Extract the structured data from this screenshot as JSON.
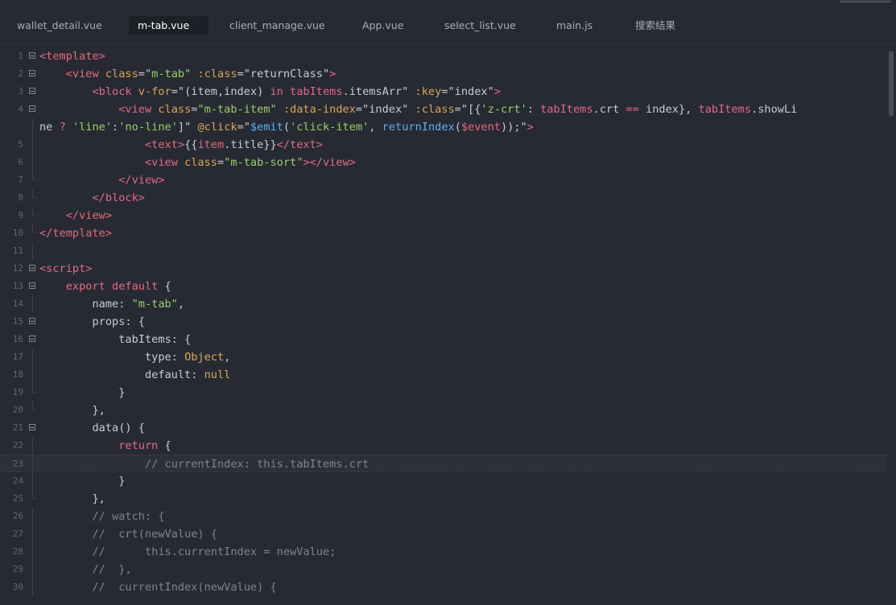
{
  "tabs": [
    {
      "label": "wallet_detail.vue",
      "active": false
    },
    {
      "label": "m-tab.vue",
      "active": true
    },
    {
      "label": "client_manage.vue",
      "active": false
    },
    {
      "label": "App.vue",
      "active": false
    },
    {
      "label": "select_list.vue",
      "active": false
    },
    {
      "label": "main.js",
      "active": false
    },
    {
      "label": "搜索结果",
      "active": false
    }
  ],
  "colors": {
    "background": "#272a33",
    "tag": "#e26a84",
    "attribute": "#d9a657",
    "string": "#9ad06a",
    "function": "#61aeee",
    "comment": "#7f848e"
  },
  "lines": [
    {
      "n": "1",
      "fold": "open",
      "tokens": [
        [
          "tag",
          "<template"
        ],
        [
          "tag",
          ">"
        ]
      ]
    },
    {
      "n": "2",
      "fold": "open",
      "tokens": [
        [
          "plain",
          "    "
        ],
        [
          "tag",
          "<view "
        ],
        [
          "attr",
          "class"
        ],
        [
          "plain",
          "="
        ],
        [
          "str",
          "\"m-tab\""
        ],
        [
          "plain",
          " "
        ],
        [
          "attr",
          ":class"
        ],
        [
          "plain",
          "=\"returnClass\""
        ],
        [
          "tag",
          ">"
        ]
      ]
    },
    {
      "n": "3",
      "fold": "open",
      "tokens": [
        [
          "plain",
          "        "
        ],
        [
          "tag",
          "<block "
        ],
        [
          "attr",
          "v-for"
        ],
        [
          "plain",
          "=\"(item,index) "
        ],
        [
          "kw",
          "in "
        ],
        [
          "var",
          "tabItems"
        ],
        [
          "plain",
          ".itemsArr\" "
        ],
        [
          "attr",
          ":key"
        ],
        [
          "plain",
          "=\"index\""
        ],
        [
          "tag",
          ">"
        ]
      ]
    },
    {
      "n": "4",
      "fold": "open",
      "tokens": [
        [
          "plain",
          "            "
        ],
        [
          "tag",
          "<view "
        ],
        [
          "attr",
          "class"
        ],
        [
          "plain",
          "="
        ],
        [
          "str",
          "\"m-tab-item\""
        ],
        [
          "plain",
          " "
        ],
        [
          "attr",
          ":data-index"
        ],
        [
          "plain",
          "=\"index\" "
        ],
        [
          "attr",
          ":class"
        ],
        [
          "plain",
          "=\"[{"
        ],
        [
          "str",
          "'z-crt'"
        ],
        [
          "plain",
          ": "
        ],
        [
          "var",
          "tabItems"
        ],
        [
          "plain",
          ".crt "
        ],
        [
          "kw",
          "=="
        ],
        [
          "plain",
          " index}, "
        ],
        [
          "var",
          "tabItems"
        ],
        [
          "plain",
          ".showLi"
        ]
      ]
    },
    {
      "n": "",
      "fold": "",
      "tokens": [
        [
          "plain",
          "ne "
        ],
        [
          "kw",
          "? "
        ],
        [
          "str",
          "'line'"
        ],
        [
          "plain",
          ":"
        ],
        [
          "str",
          "'no-line'"
        ],
        [
          "plain",
          "]\" "
        ],
        [
          "attr",
          "@click"
        ],
        [
          "plain",
          "=\""
        ],
        [
          "fn",
          "$emit"
        ],
        [
          "plain",
          "("
        ],
        [
          "str",
          "'click-item'"
        ],
        [
          "plain",
          ", "
        ],
        [
          "fn",
          "returnIndex"
        ],
        [
          "plain",
          "("
        ],
        [
          "var",
          "$event"
        ],
        [
          "plain",
          "));\""
        ],
        [
          "tag",
          ">"
        ]
      ]
    },
    {
      "n": "5",
      "fold": "",
      "tokens": [
        [
          "plain",
          "                "
        ],
        [
          "tag",
          "<text"
        ],
        [
          "tag",
          ">"
        ],
        [
          "plain",
          "{{"
        ],
        [
          "var",
          "item"
        ],
        [
          "plain",
          ".title}}"
        ],
        [
          "tag",
          "</text>"
        ]
      ]
    },
    {
      "n": "6",
      "fold": "",
      "tokens": [
        [
          "plain",
          "                "
        ],
        [
          "tag",
          "<view "
        ],
        [
          "attr",
          "class"
        ],
        [
          "plain",
          "="
        ],
        [
          "str",
          "\"m-tab-sort\""
        ],
        [
          "tag",
          "></view>"
        ]
      ]
    },
    {
      "n": "7",
      "fold": "end",
      "tokens": [
        [
          "plain",
          "            "
        ],
        [
          "tag",
          "</view>"
        ]
      ]
    },
    {
      "n": "8",
      "fold": "end",
      "tokens": [
        [
          "plain",
          "        "
        ],
        [
          "tag",
          "</block>"
        ]
      ]
    },
    {
      "n": "9",
      "fold": "end",
      "tokens": [
        [
          "plain",
          "    "
        ],
        [
          "tag",
          "</view>"
        ]
      ]
    },
    {
      "n": "10",
      "fold": "end",
      "tokens": [
        [
          "tag",
          "</template>"
        ]
      ]
    },
    {
      "n": "11",
      "fold": "",
      "tokens": []
    },
    {
      "n": "12",
      "fold": "open",
      "tokens": [
        [
          "tag",
          "<script"
        ],
        [
          "tag",
          ">"
        ]
      ]
    },
    {
      "n": "13",
      "fold": "open",
      "tokens": [
        [
          "plain",
          "    "
        ],
        [
          "kw",
          "export "
        ],
        [
          "kw",
          "default "
        ],
        [
          "plain",
          "{"
        ]
      ]
    },
    {
      "n": "14",
      "fold": "",
      "tokens": [
        [
          "plain",
          "        name: "
        ],
        [
          "str",
          "\"m-tab\""
        ],
        [
          "plain",
          ","
        ]
      ]
    },
    {
      "n": "15",
      "fold": "open",
      "tokens": [
        [
          "plain",
          "        props: {"
        ]
      ]
    },
    {
      "n": "16",
      "fold": "open",
      "tokens": [
        [
          "plain",
          "            tabItems: {"
        ]
      ]
    },
    {
      "n": "17",
      "fold": "",
      "tokens": [
        [
          "plain",
          "                type: "
        ],
        [
          "attr",
          "Object"
        ],
        [
          "plain",
          ","
        ]
      ]
    },
    {
      "n": "18",
      "fold": "",
      "tokens": [
        [
          "plain",
          "                default: "
        ],
        [
          "attr",
          "null"
        ]
      ]
    },
    {
      "n": "19",
      "fold": "end",
      "tokens": [
        [
          "plain",
          "            }"
        ]
      ]
    },
    {
      "n": "20",
      "fold": "end",
      "tokens": [
        [
          "plain",
          "        },"
        ]
      ]
    },
    {
      "n": "21",
      "fold": "open",
      "tokens": [
        [
          "plain",
          "        data() {"
        ]
      ]
    },
    {
      "n": "22",
      "fold": "",
      "tokens": [
        [
          "plain",
          "            "
        ],
        [
          "kw",
          "return "
        ],
        [
          "plain",
          "{"
        ]
      ]
    },
    {
      "n": "23",
      "fold": "",
      "current": true,
      "tokens": [
        [
          "plain",
          "                "
        ],
        [
          "com",
          "// currentIndex: this.tabItems.crt"
        ]
      ]
    },
    {
      "n": "24",
      "fold": "",
      "tokens": [
        [
          "plain",
          "            }"
        ]
      ]
    },
    {
      "n": "25",
      "fold": "end",
      "tokens": [
        [
          "plain",
          "        },"
        ]
      ]
    },
    {
      "n": "26",
      "fold": "",
      "tokens": [
        [
          "plain",
          "        "
        ],
        [
          "com",
          "// watch: {"
        ]
      ]
    },
    {
      "n": "27",
      "fold": "",
      "tokens": [
        [
          "plain",
          "        "
        ],
        [
          "com",
          "//  crt(newValue) {"
        ]
      ]
    },
    {
      "n": "28",
      "fold": "",
      "tokens": [
        [
          "plain",
          "        "
        ],
        [
          "com",
          "//      this.currentIndex = newValue;"
        ]
      ]
    },
    {
      "n": "29",
      "fold": "",
      "tokens": [
        [
          "plain",
          "        "
        ],
        [
          "com",
          "//  },"
        ]
      ]
    },
    {
      "n": "30",
      "fold": "",
      "tokens": [
        [
          "plain",
          "        "
        ],
        [
          "com",
          "//  currentIndex(newValue) {"
        ]
      ]
    }
  ]
}
